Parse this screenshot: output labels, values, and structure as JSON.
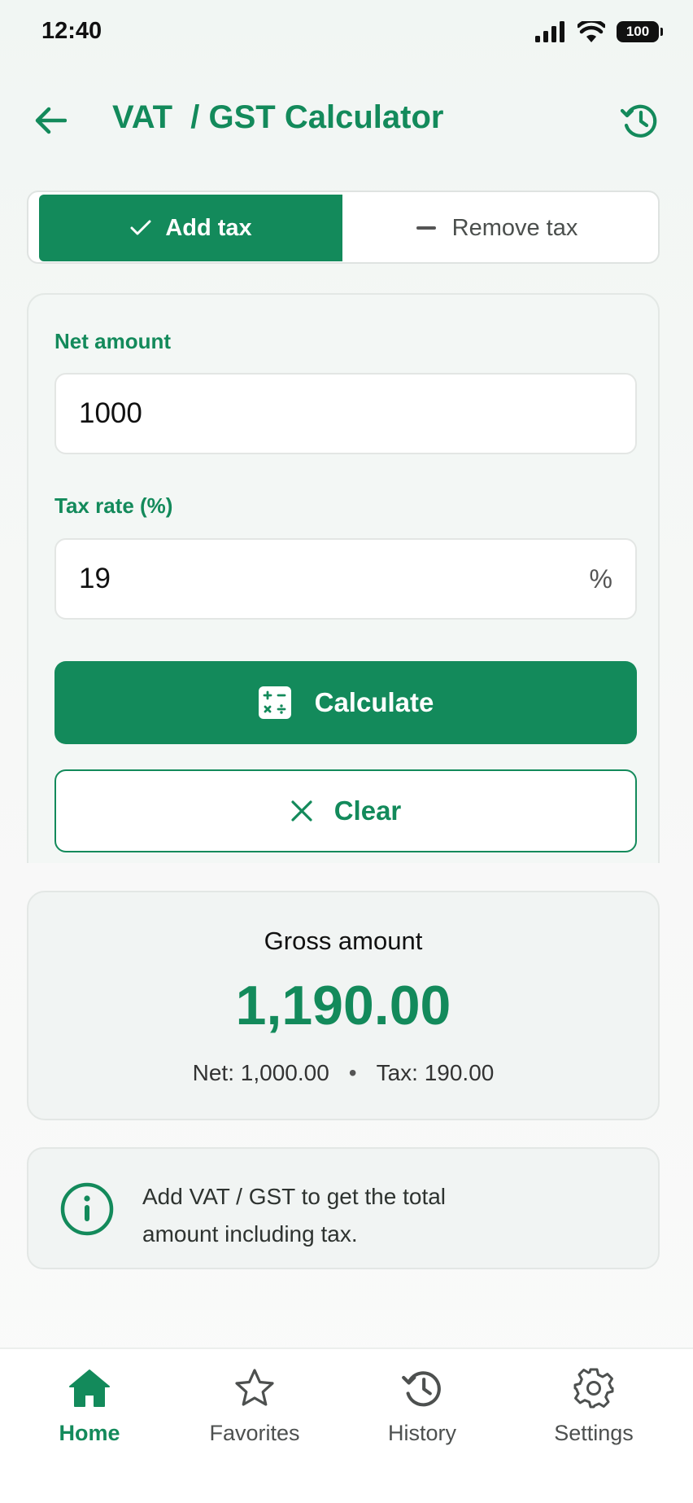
{
  "status_bar": {
    "time": "12:40",
    "battery": "100"
  },
  "header": {
    "title": "VAT  / GST Calculator"
  },
  "mode_toggle": {
    "add_label": "Add tax",
    "remove_label": "Remove tax",
    "selected": "Add tax"
  },
  "form": {
    "net_label": "Net amount",
    "net_value": "1000",
    "rate_label": "Tax rate (%)",
    "rate_value": "19",
    "rate_suffix": "%",
    "calculate_label": "Calculate",
    "clear_label": "Clear"
  },
  "result": {
    "label": "Gross amount",
    "value": "1,190.00",
    "net": "Net: 1,000.00",
    "separator": "•",
    "tax": "Tax: 190.00"
  },
  "info": {
    "text": "Add VAT / GST to get the total amount including tax."
  },
  "nav": [
    {
      "label": "Home",
      "icon": "home-icon",
      "active": true
    },
    {
      "label": "Favorites",
      "icon": "star-icon",
      "active": false
    },
    {
      "label": "History",
      "icon": "history-icon",
      "active": false
    },
    {
      "label": "Settings",
      "icon": "gear-icon",
      "active": false
    }
  ],
  "colors": {
    "accent": "#138a5b",
    "background": "#f4f7f5",
    "card": "#f1f4f3"
  }
}
